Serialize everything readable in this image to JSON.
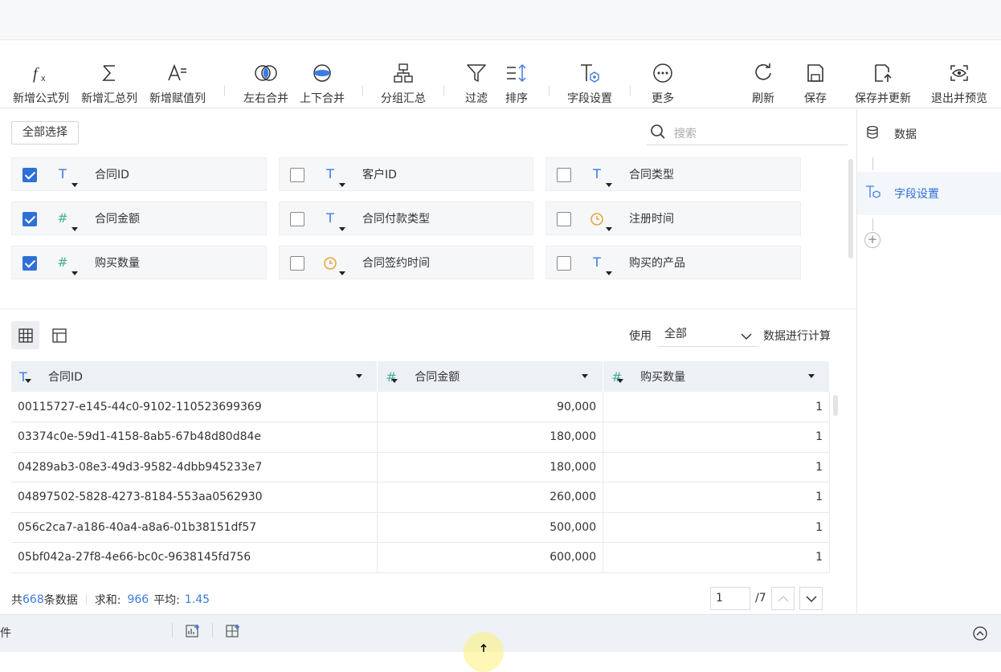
{
  "toolbar": {
    "items": [
      {
        "label": "新增公式列",
        "icon": "formula-icon"
      },
      {
        "label": "新增汇总列",
        "icon": "sigma-icon"
      },
      {
        "label": "新增赋值列",
        "icon": "assign-icon"
      },
      {
        "label": "左右合并",
        "icon": "merge-horizontal-icon"
      },
      {
        "label": "上下合并",
        "icon": "merge-vertical-icon"
      },
      {
        "label": "分组汇总",
        "icon": "group-icon"
      },
      {
        "label": "过滤",
        "icon": "filter-icon"
      },
      {
        "label": "排序",
        "icon": "sort-icon"
      },
      {
        "label": "字段设置",
        "icon": "field-settings-icon"
      },
      {
        "label": "更多",
        "icon": "more-icon"
      },
      {
        "label": "刷新",
        "icon": "refresh-icon"
      },
      {
        "label": "保存",
        "icon": "save-icon"
      },
      {
        "label": "保存并更新",
        "icon": "save-update-icon"
      },
      {
        "label": "退出并预览",
        "icon": "preview-icon"
      }
    ]
  },
  "fields_panel": {
    "select_all": "全部选择",
    "search_placeholder": "搜索",
    "fields": [
      {
        "name": "合同ID",
        "type": "text",
        "checked": true
      },
      {
        "name": "客户ID",
        "type": "text",
        "checked": false
      },
      {
        "name": "合同类型",
        "type": "text",
        "checked": false
      },
      {
        "name": "合同金额",
        "type": "number",
        "checked": true
      },
      {
        "name": "合同付款类型",
        "type": "text",
        "checked": false
      },
      {
        "name": "注册时间",
        "type": "date",
        "checked": false
      },
      {
        "name": "购买数量",
        "type": "number",
        "checked": true
      },
      {
        "name": "合同签约时间",
        "type": "date",
        "checked": false
      },
      {
        "name": "购买的产品",
        "type": "text",
        "checked": false
      }
    ]
  },
  "preview": {
    "use_label": "使用",
    "use_value": "全部",
    "calc_label": "数据进行计算",
    "columns": [
      "合同ID",
      "合同金额",
      "购买数量"
    ],
    "rows": [
      [
        "00115727-e145-44c0-9102-110523699369",
        "90,000",
        "1"
      ],
      [
        "03374c0e-59d1-4158-8ab5-67b48d80d84e",
        "180,000",
        "1"
      ],
      [
        "04289ab3-08e3-49d3-9582-4dbb945233e7",
        "180,000",
        "1"
      ],
      [
        "04897502-5828-4273-8184-553aa0562930",
        "260,000",
        "1"
      ],
      [
        "056c2ca7-a186-40a4-a8a6-01b38151df57",
        "500,000",
        "1"
      ],
      [
        "05bf042a-27f8-4e66-bc0c-9638145fd756",
        "600,000",
        "1"
      ]
    ],
    "footer": {
      "total_prefix": "共",
      "total_count": "668",
      "total_suffix": "条数据",
      "sum_label": "求和:",
      "sum_value": "966",
      "avg_label": "平均:",
      "avg_value": "1.45",
      "page_current": "1",
      "page_total": "/7"
    }
  },
  "right_panel": {
    "items": [
      {
        "label": "数据",
        "icon": "database-icon"
      },
      {
        "label": "字段设置",
        "icon": "field-settings-icon"
      }
    ]
  },
  "bottom": {
    "label": "件"
  },
  "colors": {
    "accent": "#2f6fd6",
    "type_text": "#3d7be0",
    "type_number": "#4caf9a",
    "type_date": "#e8a33a"
  }
}
